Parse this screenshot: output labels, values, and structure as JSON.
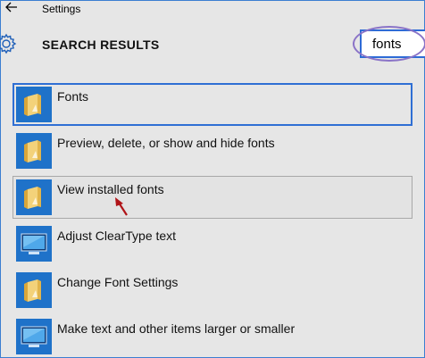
{
  "window": {
    "title": "Settings"
  },
  "header": {
    "title": "SEARCH RESULTS"
  },
  "search": {
    "value": "fonts"
  },
  "results": [
    {
      "label": "Fonts",
      "icon": "folder-icon"
    },
    {
      "label": "Preview, delete, or show and hide fonts",
      "icon": "folder-icon"
    },
    {
      "label": "View installed fonts",
      "icon": "folder-icon"
    },
    {
      "label": "Adjust ClearType text",
      "icon": "monitor-icon"
    },
    {
      "label": "Change Font Settings",
      "icon": "folder-icon"
    },
    {
      "label": "Make text and other items larger or smaller",
      "icon": "monitor-icon"
    }
  ],
  "colors": {
    "accent": "#2f6fd4",
    "tile": "#1f72c9",
    "background": "#e6e6e6",
    "annotation_oval": "#8a73c7",
    "annotation_arrow": "#b01418"
  }
}
